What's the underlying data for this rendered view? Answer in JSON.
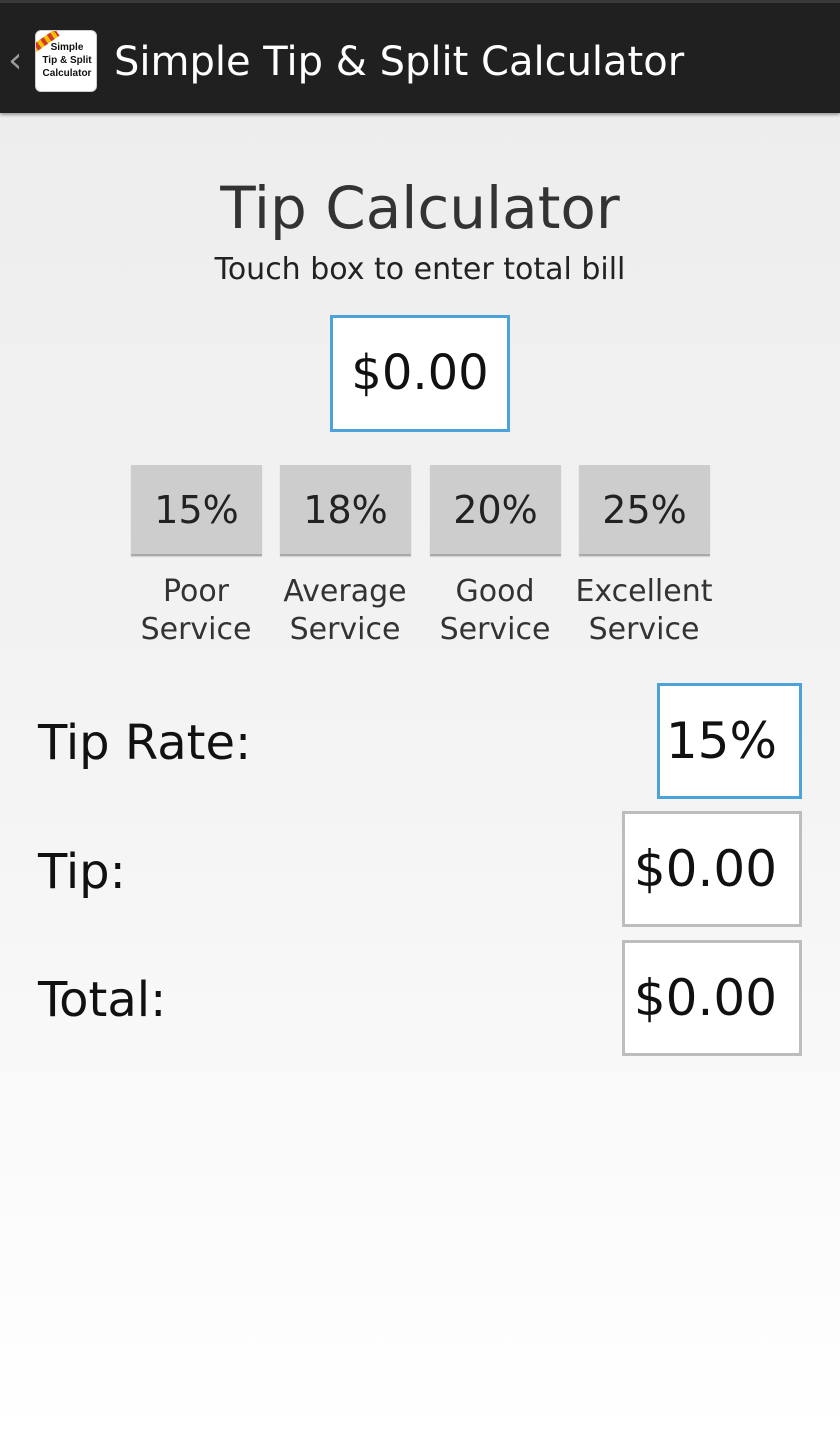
{
  "action_bar": {
    "title": "Simple Tip & Split Calculator",
    "icon_text_lines": [
      "Simple",
      "Tip & Split",
      "Calculator"
    ]
  },
  "header": {
    "title": "Tip Calculator",
    "subtitle": "Touch box to enter total bill"
  },
  "bill": {
    "value": "$0.00"
  },
  "tip_options": [
    {
      "percent": "15%",
      "label_line1": "Poor",
      "label_line2": "Service"
    },
    {
      "percent": "18%",
      "label_line1": "Average",
      "label_line2": "Service"
    },
    {
      "percent": "20%",
      "label_line1": "Good",
      "label_line2": "Service"
    },
    {
      "percent": "25%",
      "label_line1": "Excellent",
      "label_line2": "Service"
    }
  ],
  "results": {
    "tip_rate_label": "Tip Rate:",
    "tip_rate_value": "15%",
    "tip_label": "Tip:",
    "tip_value": "$0.00",
    "total_label": "Total:",
    "total_value": "$0.00"
  },
  "colors": {
    "action_bar_bg": "#202020",
    "accent_border": "#4ba3d9",
    "neutral_border": "#bdbdbd",
    "button_bg": "#cdcdcd"
  },
  "icons": {
    "back": "chevron-left-icon",
    "app": "app-logo-icon"
  }
}
